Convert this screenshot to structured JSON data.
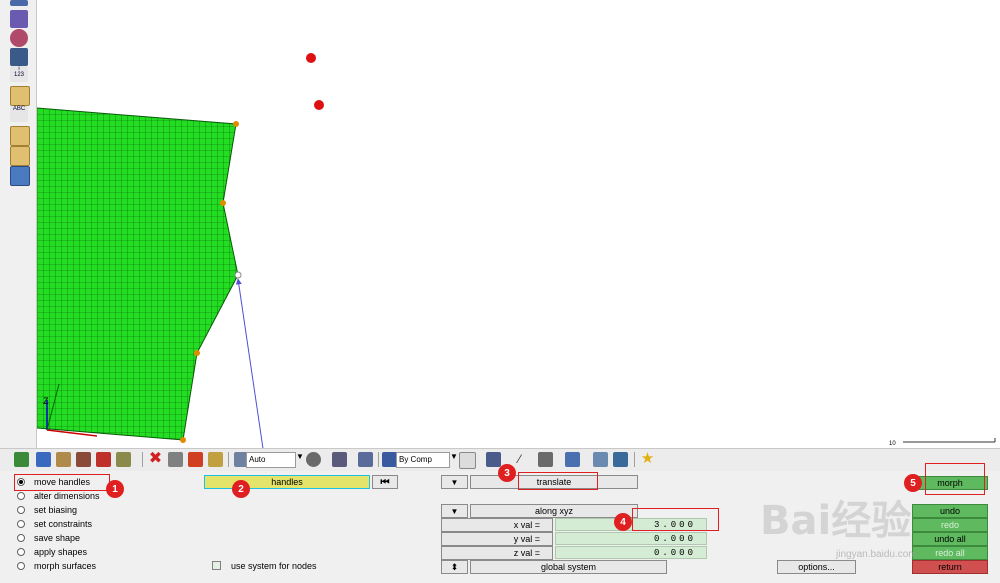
{
  "viewport": {
    "scale_label": "10",
    "triad_label": "Z"
  },
  "toolbar": {
    "auto_label": "Auto",
    "bycomp_label": "By Comp"
  },
  "panel": {
    "modes": [
      {
        "label": "move handles",
        "selected": true
      },
      {
        "label": "alter dimensions",
        "selected": false
      },
      {
        "label": "set biasing",
        "selected": false
      },
      {
        "label": "set constraints",
        "selected": false
      },
      {
        "label": "save shape",
        "selected": false
      },
      {
        "label": "apply shapes",
        "selected": false
      },
      {
        "label": "morph surfaces",
        "selected": false
      }
    ],
    "handles_label": "handles",
    "use_system_label": "use system for nodes",
    "translate_label": "translate",
    "along_label": "along xyz",
    "x_label": "x val =",
    "y_label": "y val =",
    "z_label": "z val =",
    "x_value": "3.000",
    "y_value": "0.000",
    "z_value": "0.000",
    "global_label": "global system",
    "options_label": "options...",
    "morph_label": "morph",
    "undo_label": "undo",
    "redo_label": "redo",
    "undo_all_label": "undo all",
    "redo_all_label": "redo all",
    "return_label": "return"
  },
  "callouts": [
    "1",
    "2",
    "3",
    "4",
    "5"
  ],
  "watermark": {
    "text": "Bai经验",
    "url": "jingyan.baidu.com"
  },
  "colors": {
    "mesh": "#22dd22",
    "handle": "#e08a00",
    "selected_node": "#dd1111",
    "accent_green": "#5fb95f",
    "accent_red": "#d05050",
    "field_green": "#d4ecd4"
  }
}
